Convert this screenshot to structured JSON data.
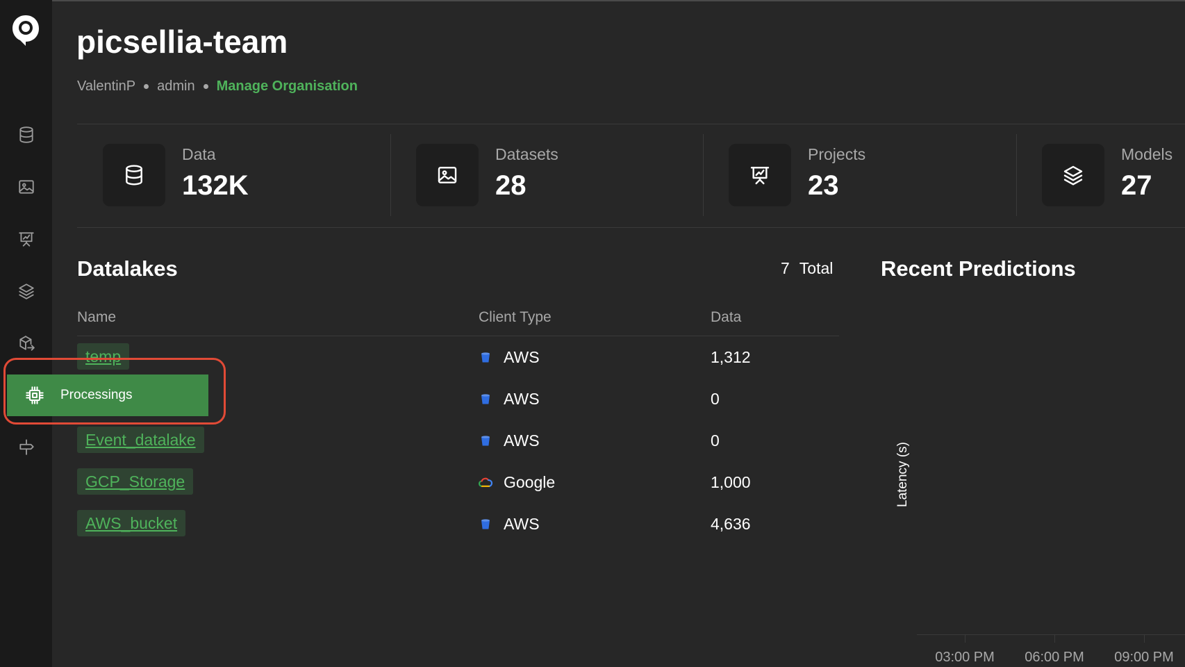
{
  "header": {
    "org_name": "picsellia-team",
    "user": "ValentinP",
    "role": "admin",
    "manage_link": "Manage Organisation"
  },
  "sidebar": {
    "items": [
      {
        "name": "data",
        "icon": "database-icon"
      },
      {
        "name": "datasets",
        "icon": "image-icon"
      },
      {
        "name": "projects",
        "icon": "presentation-chart-icon"
      },
      {
        "name": "models",
        "icon": "layers-icon"
      },
      {
        "name": "deployments",
        "icon": "package-export-icon"
      },
      {
        "name": "processings",
        "icon": "cpu-chip-icon"
      },
      {
        "name": "signpost",
        "icon": "signpost-icon"
      }
    ],
    "tooltip_label": "Processings"
  },
  "stats": [
    {
      "label": "Data",
      "value": "132K",
      "icon": "database-icon"
    },
    {
      "label": "Datasets",
      "value": "28",
      "icon": "image-icon"
    },
    {
      "label": "Projects",
      "value": "23",
      "icon": "presentation-chart-icon"
    },
    {
      "label": "Models",
      "value": "27",
      "icon": "layers-icon"
    }
  ],
  "datalakes": {
    "title": "Datalakes",
    "total_count": "7",
    "total_label": "Total",
    "columns": [
      "Name",
      "Client Type",
      "Data"
    ],
    "rows": [
      {
        "name": "temp",
        "client": "AWS",
        "client_icon": "aws-bucket-icon",
        "data": "1,312"
      },
      {
        "name": "",
        "client": "AWS",
        "client_icon": "aws-bucket-icon",
        "data": "0"
      },
      {
        "name": "Event_datalake",
        "client": "AWS",
        "client_icon": "aws-bucket-icon",
        "data": "0"
      },
      {
        "name": "GCP_Storage",
        "client": "Google",
        "client_icon": "google-cloud-icon",
        "data": "1,000"
      },
      {
        "name": "AWS_bucket",
        "client": "AWS",
        "client_icon": "aws-bucket-icon",
        "data": "4,636"
      }
    ]
  },
  "recent_predictions": {
    "title": "Recent Predictions",
    "y_axis_label": "Latency (s)",
    "x_ticks": [
      "03:00 PM",
      "06:00 PM",
      "09:00 PM"
    ]
  },
  "colors": {
    "accent_green": "#4fb35b",
    "highlight_red": "#e14a36",
    "aws_blue": "#2f6de1"
  }
}
